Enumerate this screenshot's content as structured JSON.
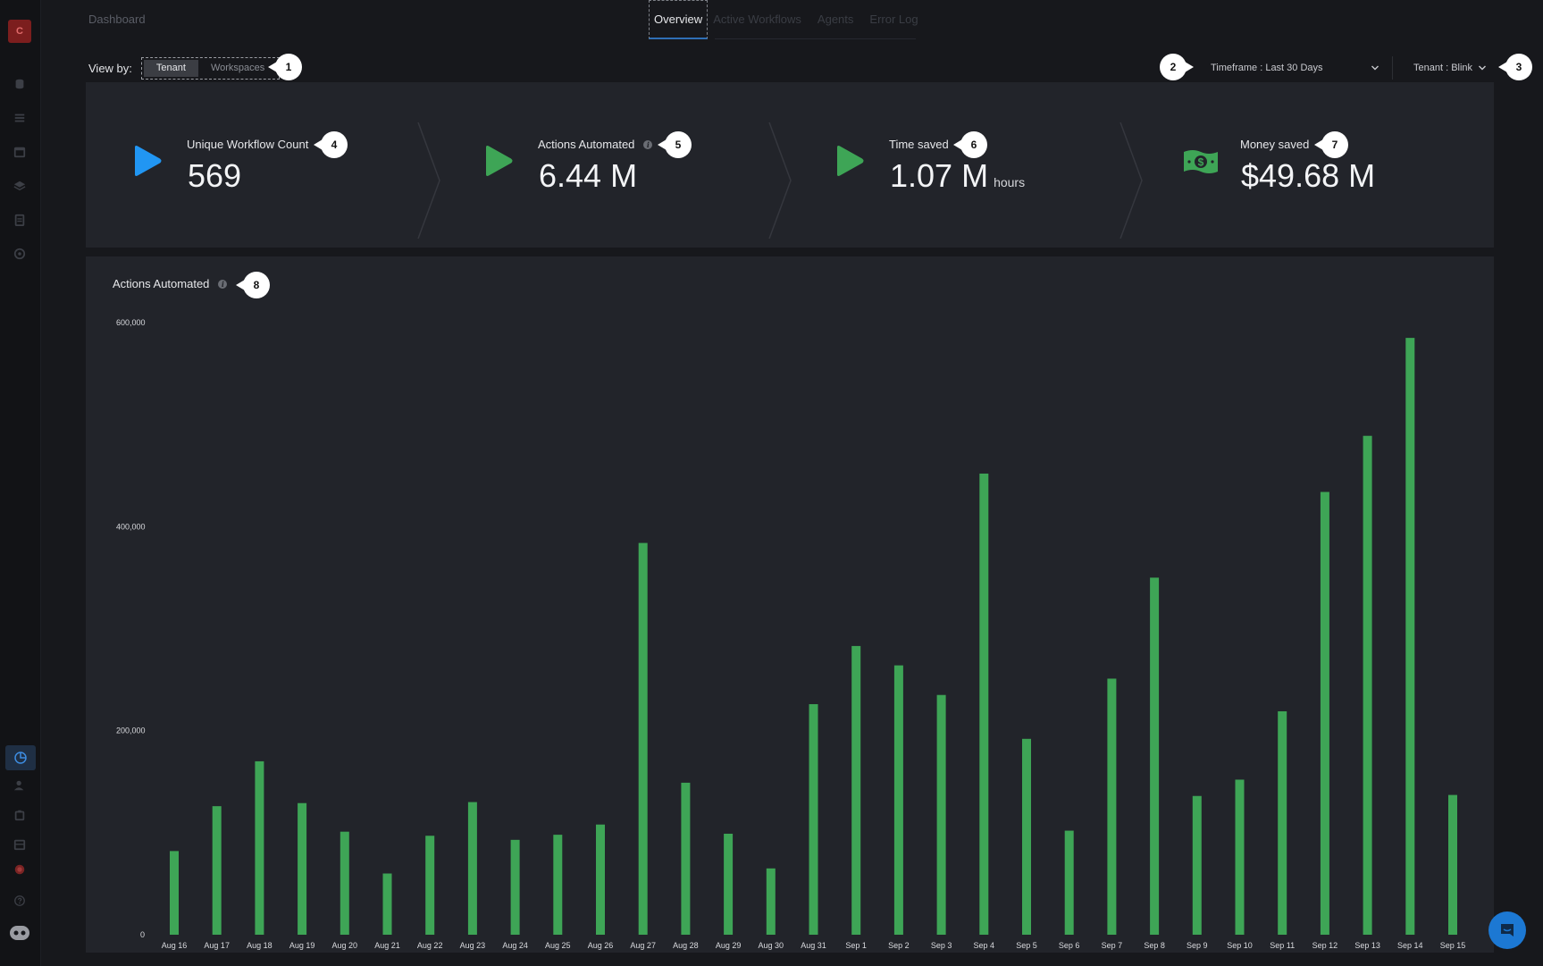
{
  "app": {
    "logo_letter": "C"
  },
  "header": {
    "breadcrumb": "Dashboard",
    "tabs": [
      {
        "label": "Overview",
        "active": true
      },
      {
        "label": "Active Workflows",
        "active": false
      },
      {
        "label": "Agents",
        "active": false
      },
      {
        "label": "Error Log",
        "active": false
      }
    ]
  },
  "view_by": {
    "label": "View by:",
    "options": [
      {
        "label": "Tenant",
        "active": true
      },
      {
        "label": "Workspaces",
        "active": false
      }
    ]
  },
  "filters": {
    "timeframe": "Timeframe : Last 30 Days",
    "tenant": "Tenant : Blink"
  },
  "markers": [
    "1",
    "2",
    "3",
    "4",
    "5",
    "6",
    "7",
    "8"
  ],
  "stats": [
    {
      "label": "Unique Workflow Count",
      "value": "569",
      "unit": "",
      "icon": "play-blue-icon",
      "color": "#2196f3"
    },
    {
      "label": "Actions Automated",
      "value": "6.44 M",
      "unit": "",
      "icon": "play-green-icon",
      "color": "#3ea556",
      "info": true
    },
    {
      "label": "Time saved",
      "value": "1.07 M",
      "unit": "hours",
      "icon": "play-green-icon",
      "color": "#3ea556"
    },
    {
      "label": "Money saved",
      "value": "$49.68 M",
      "unit": "",
      "icon": "money-icon",
      "color": "#3ea556"
    }
  ],
  "chart_panel": {
    "title": "Actions Automated",
    "info_glyph": "i"
  },
  "chart_data": {
    "type": "bar",
    "title": "Actions Automated",
    "categories": [
      "Aug 16",
      "Aug 17",
      "Aug 18",
      "Aug 19",
      "Aug 20",
      "Aug 21",
      "Aug 22",
      "Aug 23",
      "Aug 24",
      "Aug 25",
      "Aug 26",
      "Aug 27",
      "Aug 28",
      "Aug 29",
      "Aug 30",
      "Aug 31",
      "Sep 1",
      "Sep 2",
      "Sep 3",
      "Sep 4",
      "Sep 5",
      "Sep 6",
      "Sep 7",
      "Sep 8",
      "Sep 9",
      "Sep 10",
      "Sep 11",
      "Sep 12",
      "Sep 13",
      "Sep 14",
      "Sep 15"
    ],
    "values": [
      82000,
      126000,
      170000,
      129000,
      101000,
      60000,
      97000,
      130000,
      93000,
      98000,
      108000,
      384000,
      149000,
      99000,
      65000,
      226000,
      283000,
      264000,
      235000,
      452000,
      192000,
      102000,
      251000,
      350000,
      136000,
      152000,
      219000,
      434000,
      489000,
      585000,
      137000
    ],
    "yticks": [
      0,
      200000,
      400000,
      600000
    ],
    "ytick_labels": [
      "0",
      "200,000",
      "400,000",
      "600,000"
    ],
    "ylim": [
      0,
      600000
    ],
    "bar_color": "#3ea556",
    "grid": false,
    "legend": "none"
  }
}
